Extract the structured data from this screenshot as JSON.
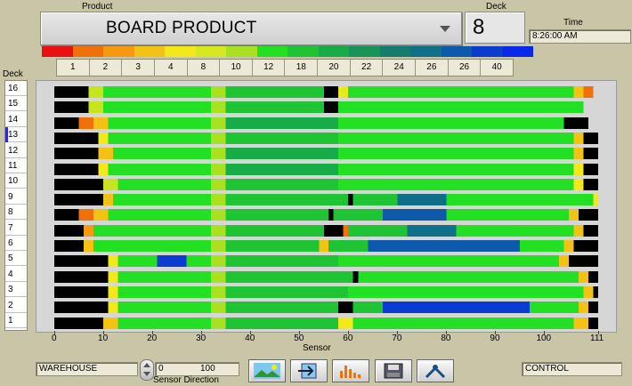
{
  "header": {
    "product_label": "Product",
    "product_value": "BOARD PRODUCT",
    "deck_label": "Deck",
    "deck_value": "8",
    "time_label": "Time",
    "time_value": "8:26:00 AM"
  },
  "legend": {
    "colors": [
      "#e81010",
      "#f0700a",
      "#f59a10",
      "#f2c314",
      "#f2e81a",
      "#d6e81e",
      "#a8e022",
      "#24e024",
      "#1ec434",
      "#18ac48",
      "#18945a",
      "#147c6e",
      "#10708a",
      "#0e5aaa",
      "#0a3cd0",
      "#0a28e8"
    ],
    "values": [
      "1",
      "2",
      "3",
      "4",
      "8",
      "10",
      "12",
      "18",
      "20",
      "22",
      "24",
      "26",
      "26",
      "40"
    ]
  },
  "deck_list": {
    "label": "Deck",
    "items": [
      "16",
      "15",
      "14",
      "13",
      "12",
      "11",
      "10",
      "9",
      "8",
      "7",
      "6",
      "5",
      "4",
      "3",
      "2",
      "1"
    ],
    "selected": "13"
  },
  "chart_data": {
    "type": "heatmap",
    "xlabel": "Sensor",
    "xlim": [
      0,
      111
    ],
    "x_ticks": [
      0,
      10,
      20,
      30,
      40,
      50,
      60,
      70,
      80,
      90,
      100,
      111
    ],
    "rows": [
      "16",
      "15",
      "14",
      "13",
      "12",
      "11",
      "10",
      "9",
      "8",
      "7",
      "6",
      "5",
      "4",
      "3",
      "2",
      "1"
    ],
    "segments": {
      "16": [
        [
          0,
          7,
          "#000000"
        ],
        [
          7,
          10,
          "#c8e41e"
        ],
        [
          10,
          32,
          "#24e024"
        ],
        [
          32,
          35,
          "#a8e022"
        ],
        [
          35,
          55,
          "#1ec434"
        ],
        [
          55,
          58,
          "#000000"
        ],
        [
          58,
          60,
          "#e8e81a"
        ],
        [
          60,
          106,
          "#24e024"
        ],
        [
          106,
          108,
          "#f2c314"
        ],
        [
          108,
          110,
          "#f0700a"
        ],
        [
          110,
          111,
          "#d6d6d6"
        ]
      ],
      "15": [
        [
          0,
          7,
          "#000000"
        ],
        [
          7,
          10,
          "#c8e41e"
        ],
        [
          10,
          32,
          "#24e024"
        ],
        [
          32,
          35,
          "#a8e022"
        ],
        [
          35,
          55,
          "#1ec434"
        ],
        [
          55,
          58,
          "#000000"
        ],
        [
          58,
          108,
          "#24e024"
        ],
        [
          108,
          111,
          "#d6d6d6"
        ]
      ],
      "14": [
        [
          0,
          5,
          "#000000"
        ],
        [
          5,
          8,
          "#f0700a"
        ],
        [
          8,
          11,
          "#f2c314"
        ],
        [
          11,
          32,
          "#24e024"
        ],
        [
          32,
          35,
          "#a8e022"
        ],
        [
          35,
          58,
          "#18ac48"
        ],
        [
          58,
          104,
          "#24e024"
        ],
        [
          104,
          109,
          "#000000"
        ],
        [
          109,
          111,
          "#d6d6d6"
        ]
      ],
      "13": [
        [
          0,
          9,
          "#000000"
        ],
        [
          9,
          11,
          "#f2e81a"
        ],
        [
          11,
          32,
          "#24e024"
        ],
        [
          32,
          35,
          "#a8e022"
        ],
        [
          35,
          58,
          "#1ec434"
        ],
        [
          58,
          106,
          "#24e024"
        ],
        [
          106,
          108,
          "#f2c314"
        ],
        [
          108,
          111,
          "#000000"
        ]
      ],
      "12": [
        [
          0,
          9,
          "#000000"
        ],
        [
          9,
          12,
          "#f2c314"
        ],
        [
          12,
          32,
          "#24e024"
        ],
        [
          32,
          35,
          "#a8e022"
        ],
        [
          35,
          58,
          "#18ac48"
        ],
        [
          58,
          106,
          "#24e024"
        ],
        [
          106,
          108,
          "#f2c314"
        ],
        [
          108,
          111,
          "#000000"
        ]
      ],
      "11": [
        [
          0,
          9,
          "#000000"
        ],
        [
          9,
          11,
          "#f2e81a"
        ],
        [
          11,
          32,
          "#24e024"
        ],
        [
          32,
          35,
          "#a8e022"
        ],
        [
          35,
          58,
          "#18ac48"
        ],
        [
          58,
          106,
          "#24e024"
        ],
        [
          106,
          108,
          "#f2e81a"
        ],
        [
          108,
          111,
          "#000000"
        ]
      ],
      "10": [
        [
          0,
          10,
          "#000000"
        ],
        [
          10,
          13,
          "#c8e41e"
        ],
        [
          13,
          32,
          "#24e024"
        ],
        [
          32,
          35,
          "#a8e022"
        ],
        [
          35,
          58,
          "#1ec434"
        ],
        [
          58,
          106,
          "#24e024"
        ],
        [
          106,
          108,
          "#f2e81a"
        ],
        [
          108,
          111,
          "#000000"
        ]
      ],
      "9": [
        [
          0,
          10,
          "#000000"
        ],
        [
          10,
          12,
          "#f2c314"
        ],
        [
          12,
          32,
          "#24e024"
        ],
        [
          32,
          35,
          "#a8e022"
        ],
        [
          35,
          60,
          "#1ec434"
        ],
        [
          60,
          61,
          "#000000"
        ],
        [
          61,
          70,
          "#1ec434"
        ],
        [
          70,
          80,
          "#10708a"
        ],
        [
          80,
          110,
          "#24e024"
        ],
        [
          110,
          111,
          "#f2e81a"
        ]
      ],
      "8": [
        [
          0,
          5,
          "#000000"
        ],
        [
          5,
          8,
          "#f0700a"
        ],
        [
          8,
          11,
          "#f2c314"
        ],
        [
          11,
          32,
          "#24e024"
        ],
        [
          32,
          35,
          "#a8e022"
        ],
        [
          35,
          56,
          "#1ec434"
        ],
        [
          56,
          57,
          "#000000"
        ],
        [
          57,
          67,
          "#1ec434"
        ],
        [
          67,
          80,
          "#0e5aaa"
        ],
        [
          80,
          105,
          "#24e024"
        ],
        [
          105,
          107,
          "#f2c314"
        ],
        [
          107,
          111,
          "#000000"
        ]
      ],
      "7": [
        [
          0,
          6,
          "#000000"
        ],
        [
          6,
          8,
          "#f59a10"
        ],
        [
          8,
          32,
          "#24e024"
        ],
        [
          32,
          35,
          "#a8e022"
        ],
        [
          35,
          55,
          "#1ec434"
        ],
        [
          55,
          59,
          "#000000"
        ],
        [
          59,
          60,
          "#f0700a"
        ],
        [
          60,
          72,
          "#1ec434"
        ],
        [
          72,
          82,
          "#10708a"
        ],
        [
          82,
          106,
          "#24e024"
        ],
        [
          106,
          108,
          "#f2c314"
        ],
        [
          108,
          111,
          "#000000"
        ]
      ],
      "6": [
        [
          0,
          6,
          "#000000"
        ],
        [
          6,
          8,
          "#f2c314"
        ],
        [
          8,
          32,
          "#24e024"
        ],
        [
          32,
          35,
          "#a8e022"
        ],
        [
          35,
          54,
          "#1ec434"
        ],
        [
          54,
          56,
          "#f2c314"
        ],
        [
          56,
          64,
          "#1ec434"
        ],
        [
          64,
          95,
          "#0e5aaa"
        ],
        [
          95,
          104,
          "#24e024"
        ],
        [
          104,
          106,
          "#f2c314"
        ],
        [
          106,
          111,
          "#000000"
        ]
      ],
      "5": [
        [
          0,
          11,
          "#000000"
        ],
        [
          11,
          13,
          "#f2e81a"
        ],
        [
          13,
          21,
          "#24e024"
        ],
        [
          21,
          27,
          "#0a3cd0"
        ],
        [
          27,
          32,
          "#24e024"
        ],
        [
          32,
          35,
          "#a8e022"
        ],
        [
          35,
          58,
          "#1ec434"
        ],
        [
          58,
          103,
          "#24e024"
        ],
        [
          103,
          105,
          "#f2c314"
        ],
        [
          105,
          111,
          "#000000"
        ]
      ],
      "4": [
        [
          0,
          11,
          "#000000"
        ],
        [
          11,
          13,
          "#f2e81a"
        ],
        [
          13,
          32,
          "#24e024"
        ],
        [
          32,
          35,
          "#a8e022"
        ],
        [
          35,
          61,
          "#1ec434"
        ],
        [
          61,
          62,
          "#000000"
        ],
        [
          62,
          107,
          "#24e024"
        ],
        [
          107,
          109,
          "#f2c314"
        ],
        [
          109,
          111,
          "#000000"
        ]
      ],
      "3": [
        [
          0,
          11,
          "#000000"
        ],
        [
          11,
          13,
          "#f2e81a"
        ],
        [
          13,
          32,
          "#24e024"
        ],
        [
          32,
          35,
          "#a8e022"
        ],
        [
          35,
          60,
          "#1ec434"
        ],
        [
          60,
          108,
          "#24e024"
        ],
        [
          108,
          110,
          "#f2c314"
        ],
        [
          110,
          111,
          "#000000"
        ]
      ],
      "2": [
        [
          0,
          11,
          "#000000"
        ],
        [
          11,
          13,
          "#f2e81a"
        ],
        [
          13,
          32,
          "#24e024"
        ],
        [
          32,
          35,
          "#a8e022"
        ],
        [
          35,
          58,
          "#1ec434"
        ],
        [
          58,
          61,
          "#000000"
        ],
        [
          61,
          67,
          "#1ec434"
        ],
        [
          67,
          97,
          "#0a3cd0"
        ],
        [
          97,
          107,
          "#24e024"
        ],
        [
          107,
          109,
          "#f2c314"
        ],
        [
          109,
          111,
          "#000000"
        ]
      ],
      "1": [
        [
          0,
          10,
          "#000000"
        ],
        [
          10,
          13,
          "#f2c314"
        ],
        [
          13,
          32,
          "#24e024"
        ],
        [
          32,
          35,
          "#a8e022"
        ],
        [
          35,
          58,
          "#1ec434"
        ],
        [
          58,
          61,
          "#f2e81a"
        ],
        [
          61,
          106,
          "#24e024"
        ],
        [
          106,
          109,
          "#f2c314"
        ],
        [
          109,
          111,
          "#000000"
        ]
      ]
    }
  },
  "footer": {
    "location_value": "WAREHOUSE",
    "sensor_min": "0",
    "sensor_max": "100",
    "sensor_direction_label": "Sensor Direction",
    "mode_value": "CONTROL",
    "toolbar_icons": [
      "landscape-icon",
      "arrow-right-icon",
      "bar-chart-icon",
      "save-icon",
      "tools-icon"
    ]
  }
}
